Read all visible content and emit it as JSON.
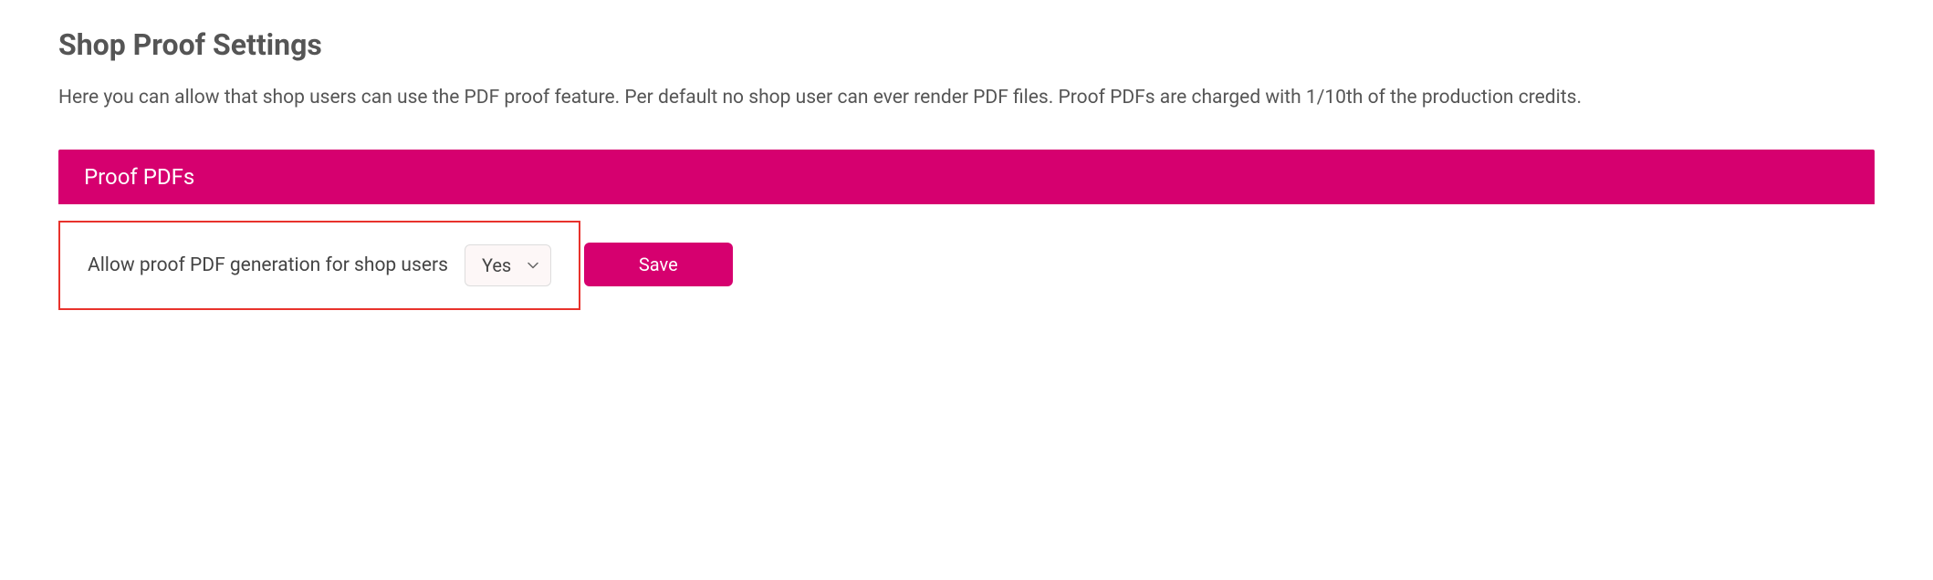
{
  "page": {
    "title": "Shop Proof Settings",
    "description": "Here you can allow that shop users can use the PDF proof feature. Per default no shop user can ever render PDF files. Proof PDFs are charged with 1/10th of the production credits."
  },
  "panel": {
    "header": "Proof PDFs",
    "setting_label": "Allow proof PDF generation for shop users",
    "selected_value": "Yes"
  },
  "actions": {
    "save_label": "Save"
  },
  "colors": {
    "accent": "#d6006f",
    "highlight_border": "#e8322c"
  }
}
